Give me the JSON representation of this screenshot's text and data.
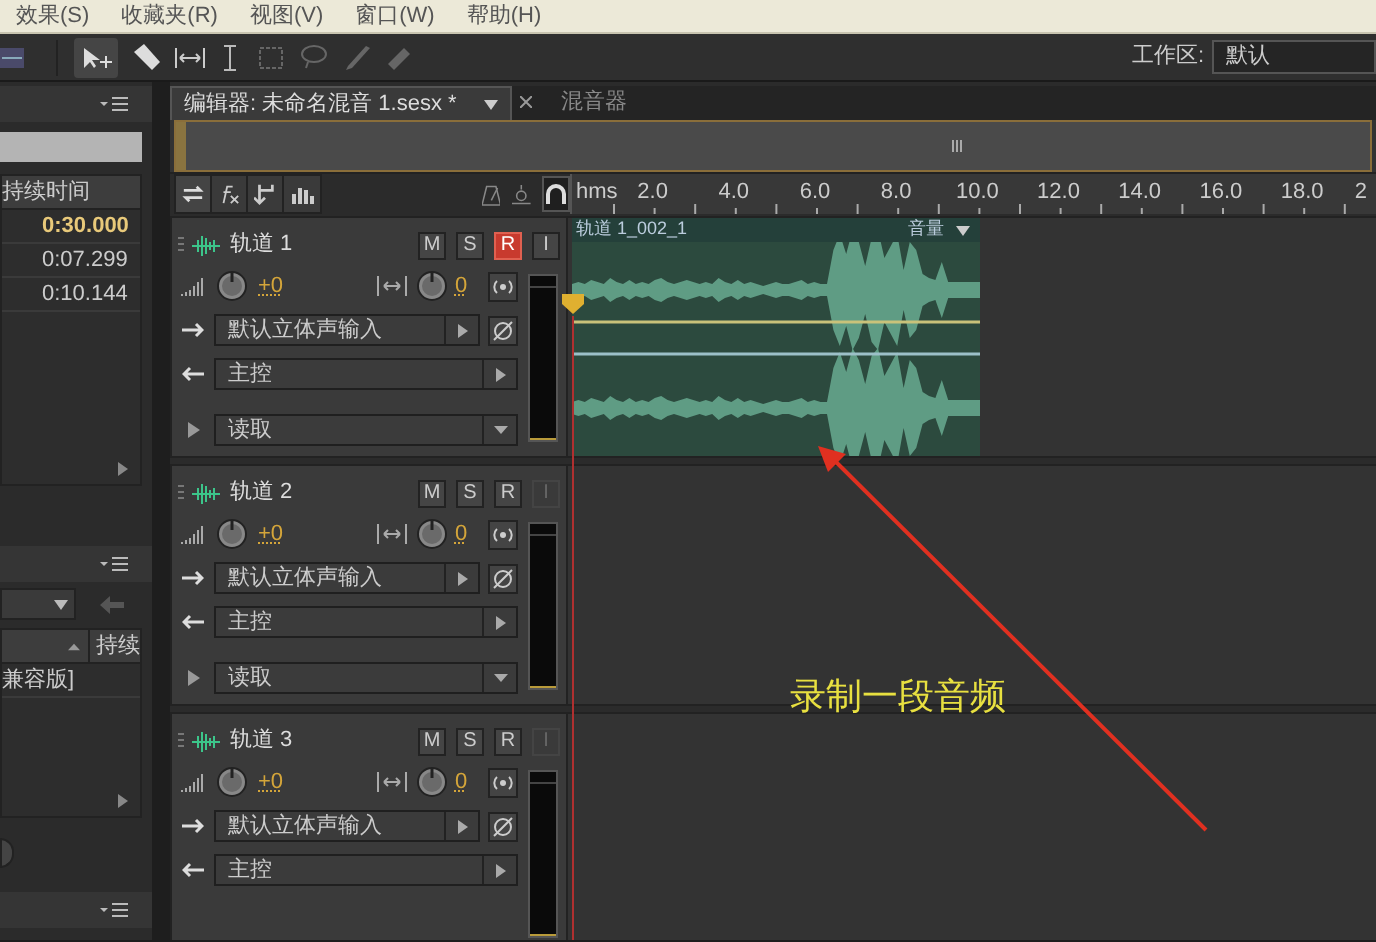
{
  "menu": [
    "效果(S)",
    "收藏夹(R)",
    "视图(V)",
    "窗口(W)",
    "帮助(H)"
  ],
  "workspace": {
    "label": "工作区:",
    "value": "默认"
  },
  "files_panel": {
    "column": "持续时间",
    "rows": [
      {
        "duration": "0:30.000",
        "selected": true
      },
      {
        "duration": "0:07.299",
        "selected": false
      },
      {
        "duration": "0:10.144",
        "selected": false
      }
    ]
  },
  "media_panel": {
    "column": "持续",
    "rows": [
      "兼容版]"
    ]
  },
  "editor_tabs": [
    {
      "label": "编辑器: 未命名混音 1.sesx *",
      "selected": true
    },
    {
      "label": "混音器",
      "selected": false
    }
  ],
  "ruler": {
    "unit": "hms",
    "labels": [
      "2.0",
      "4.0",
      "6.0",
      "8.0",
      "10.0",
      "12.0",
      "14.0",
      "16.0",
      "18.0",
      "2"
    ]
  },
  "tracks": [
    {
      "name": "轨道 1",
      "buttons": [
        {
          "label": "M",
          "on": false,
          "disabled": false
        },
        {
          "label": "S",
          "on": false,
          "disabled": false
        },
        {
          "label": "R",
          "on": true,
          "disabled": false
        },
        {
          "label": "I",
          "on": false,
          "disabled": false
        }
      ],
      "volume": "+0",
      "pan": "0",
      "input": "默认立体声输入",
      "output": "主控",
      "automation": "读取",
      "clip": {
        "name": "轨道 1_002_1",
        "envelope": "音量"
      }
    },
    {
      "name": "轨道 2",
      "buttons": [
        {
          "label": "M",
          "on": false,
          "disabled": false
        },
        {
          "label": "S",
          "on": false,
          "disabled": false
        },
        {
          "label": "R",
          "on": false,
          "disabled": false
        },
        {
          "label": "I",
          "on": false,
          "disabled": true
        }
      ],
      "volume": "+0",
      "pan": "0",
      "input": "默认立体声输入",
      "output": "主控",
      "automation": "读取"
    },
    {
      "name": "轨道 3",
      "buttons": [
        {
          "label": "M",
          "on": false,
          "disabled": false
        },
        {
          "label": "S",
          "on": false,
          "disabled": false
        },
        {
          "label": "R",
          "on": false,
          "disabled": false
        },
        {
          "label": "I",
          "on": false,
          "disabled": true
        }
      ],
      "volume": "+0",
      "pan": "0",
      "input": "默认立体声输入",
      "output": "主控"
    }
  ],
  "annotation": "录制一段音频"
}
